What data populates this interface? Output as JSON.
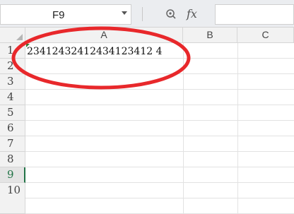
{
  "formula_bar": {
    "name_box": "F9",
    "zoom_icon": "zoom-icon",
    "fx_label": "fx",
    "formula_value": ""
  },
  "columns": [
    "A",
    "B",
    "C"
  ],
  "rows": [
    "1",
    "2",
    "3",
    "4",
    "5",
    "6",
    "7",
    "8",
    "9",
    "10"
  ],
  "active_row": "9",
  "cells": {
    "A1": "23412432412434123412 4"
  },
  "annotation": {
    "shape": "ellipse",
    "color": "#e8282b"
  }
}
